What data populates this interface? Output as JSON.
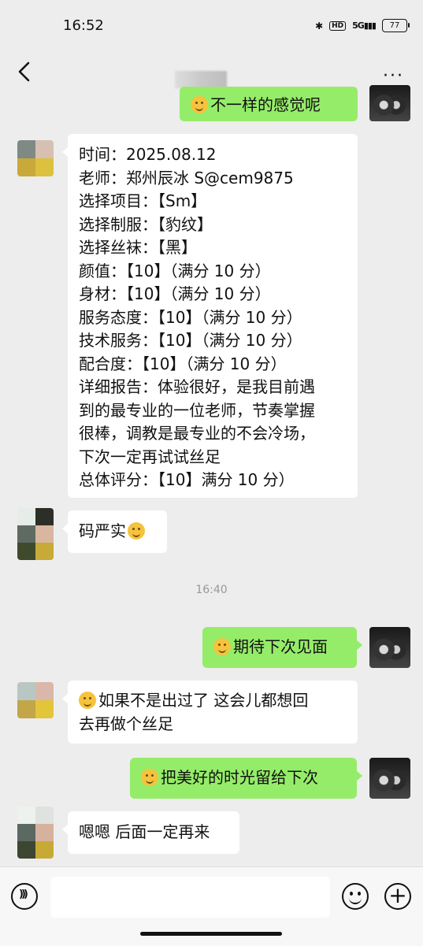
{
  "status_bar": {
    "time": "16:52",
    "hd": "HD",
    "network": "5G",
    "battery": "77"
  },
  "nav": {
    "back_icon": "chevron-left-icon",
    "more_icon": "more-dots-icon",
    "more_label": "···"
  },
  "messages": {
    "top_partial": {
      "emoji": "thinking-emoji",
      "text": "不一样的感觉呢"
    },
    "review": {
      "lines": [
        "时间：2025.08.12",
        "老师：郑州辰冰 S@cem9875",
        "选择项目：【Sm】",
        "选择制服：【豹纹】",
        "选择丝袜：【黑】",
        "颜值：【10】（满分 10 分）",
        "身材：【10】（满分 10 分）",
        "服务态度：【10】（满分 10 分）",
        "技术服务：【10】（满分 10 分）",
        "配合度：【10】（满分 10 分）",
        "详细报告：体验很好，是我目前遇",
        "到的最专业的一位老师，节奏掌握",
        "很棒，调教是最专业的不会冷场，",
        "下次一定再试试丝足",
        "总体评分：【10】满分 10 分）"
      ]
    },
    "code_strict": {
      "text": "码严实",
      "emoji": "laughing-tears-emoji"
    },
    "timestamp": "16:40",
    "see_you": {
      "emoji": "smiling-emoji",
      "text": "期待下次见面"
    },
    "if_not": {
      "emoji": "grinning-emoji",
      "line1": "如果不是出过了 这会儿都想回",
      "line2": "去再做个丝足"
    },
    "keep_time": {
      "emoji": "thinking-emoji",
      "text": "把美好的时光留给下次"
    },
    "will_come": {
      "text": "嗯嗯 后面一定再来"
    }
  },
  "input_bar": {
    "voice_icon": "voice-icon",
    "emoji_icon": "emoji-icon",
    "add_icon": "plus-icon",
    "add_label": "+"
  },
  "colors": {
    "background": "#ededed",
    "bubble_self": "#95ec69",
    "bubble_other": "#ffffff"
  }
}
